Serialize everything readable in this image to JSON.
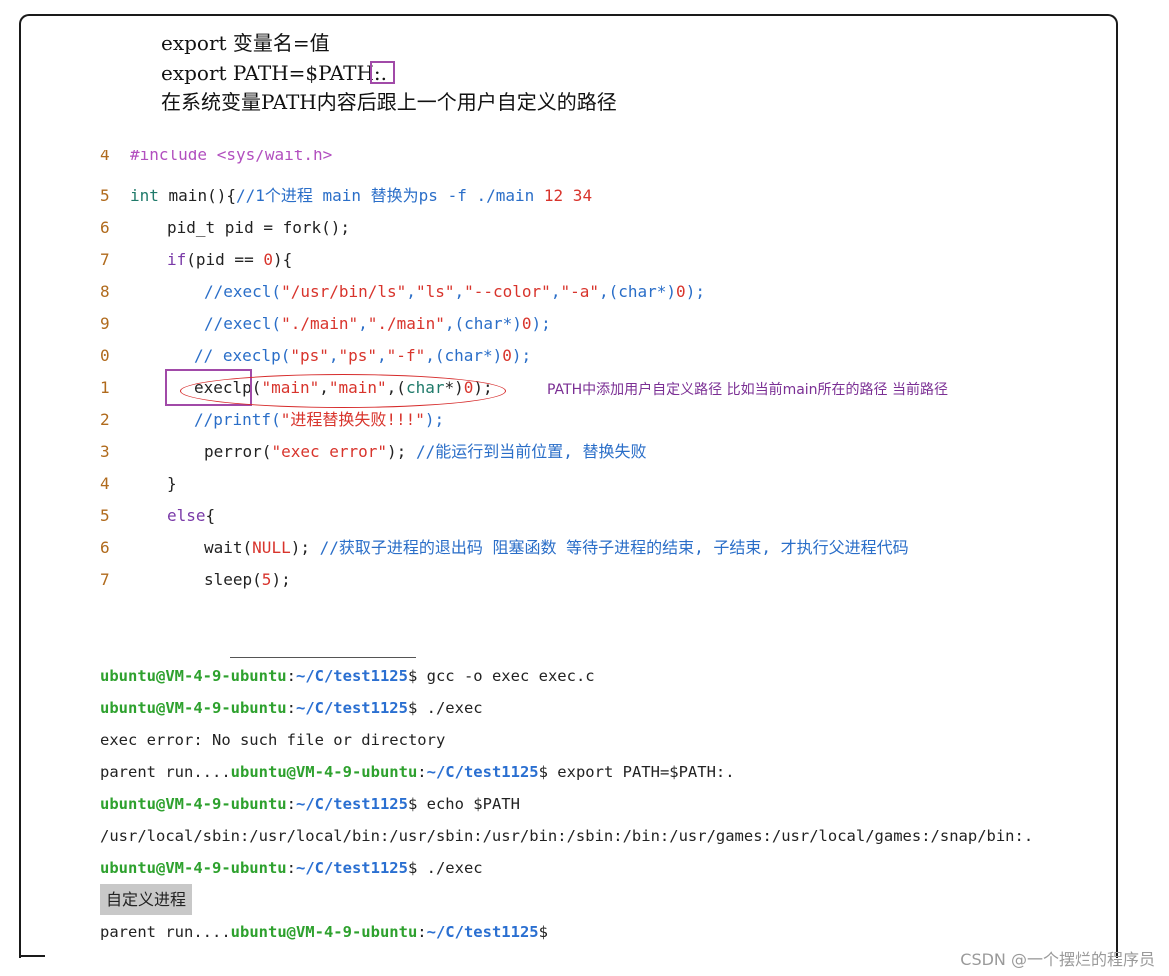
{
  "notes": {
    "line1": "export 变量名=值",
    "line2": "export PATH=$PATH:.",
    "line3": "在系统变量PATH内容后跟上一个用户自定义的路径"
  },
  "code": {
    "partial_line": {
      "num": "4",
      "text": "#include <sys/wait.h>"
    },
    "line5": {
      "num": "5",
      "kw": "int",
      "fn": " main(){",
      "cm": "//1个进程 main  替换为ps -f  ./main ",
      "n1": "12",
      "n2": " 34"
    },
    "line6": {
      "num": "6",
      "text": "pid_t pid = fork();"
    },
    "line7": {
      "num": "7",
      "kw": "if",
      "t1": "(pid == ",
      "n": "0",
      "t2": "){"
    },
    "line8": {
      "num": "8",
      "c1": "//execl(",
      "s1": "\"/usr/bin/ls\"",
      "c2": ",",
      "s2": "\"ls\"",
      "c3": ",",
      "s3": "\"--color\"",
      "c4": ",",
      "s4": "\"-a\"",
      "c5": ",(char*)",
      "n": "0",
      "c6": ");"
    },
    "line9": {
      "num": "9",
      "c1": "//execl(",
      "s1": "\"./main\"",
      "c2": ",",
      "s2": "\"./main\"",
      "c3": ",(char*)",
      "n": "0",
      "c4": ");"
    },
    "line10": {
      "num": "0",
      "c1": "// execlp(",
      "s1": "\"ps\"",
      "c2": ",",
      "s2": "\"ps\"",
      "c3": ",",
      "s3": "\"-f\"",
      "c4": ",(char*)",
      "n": "0",
      "c5": ");"
    },
    "line11": {
      "num": "1",
      "fn": "execlp(",
      "s1": "\"main\"",
      "p1": ",",
      "s2": "\"main\"",
      "p2": ",(",
      "t": "char",
      "p3": "*)",
      "n": "0",
      "p4": ");"
    },
    "line12": {
      "num": "2",
      "c1": "//printf(",
      "s1": "\"进程替换失败!!!\"",
      "c2": ");"
    },
    "line13": {
      "num": "3",
      "fn": "perror(",
      "s1": "\"exec error\"",
      "p1": "); ",
      "cm": "//能运行到当前位置, 替换失败"
    },
    "line14": {
      "num": "4",
      "text": "}"
    },
    "line15": {
      "num": "5",
      "kw": "else",
      "text": "{"
    },
    "line16": {
      "num": "6",
      "fn": "wait(",
      "n": "NULL",
      "p1": "); ",
      "cm": "//获取子进程的退出码 阻塞函数  等待子进程的结束, 子结束, 才执行父进程代码"
    },
    "line17": {
      "num": "7",
      "fn": "sleep(",
      "n": "5",
      "p1": ");"
    }
  },
  "annotation": "PATH中添加用户自定义路径 比如当前main所在的路径  当前路径",
  "terminal": {
    "user": "ubuntu@VM-4-9-ubuntu",
    "colon": ":",
    "path": "~/C/test1125",
    "lines": [
      {
        "prompt": true,
        "cmd": "$ gcc -o exec exec.c"
      },
      {
        "prompt": true,
        "cmd": "$ ./exec"
      },
      {
        "text": "exec error: No such file or directory"
      },
      {
        "prefix": "parent run....",
        "prompt": true,
        "cmd": "$ export PATH=$PATH:."
      },
      {
        "prompt": true,
        "cmd": "$ echo $PATH"
      },
      {
        "text": "/usr/local/sbin:/usr/local/bin:/usr/sbin:/usr/bin:/sbin:/bin:/usr/games:/usr/local/games:/snap/bin:."
      },
      {
        "prompt": true,
        "cmd": "$ ./exec"
      },
      {
        "highlight": "自定义进程"
      },
      {
        "prefix": "parent run....",
        "prompt": true,
        "cmd": "$"
      }
    ]
  },
  "watermark": "CSDN @一个摆烂的程序员",
  "colors": {
    "prompt_user": "#2ea12e",
    "prompt_path": "#2a6fd1",
    "box_purple": "#a14aa8",
    "ellipse_red": "#d62b2b",
    "annotation_purple": "#7b2f94"
  }
}
